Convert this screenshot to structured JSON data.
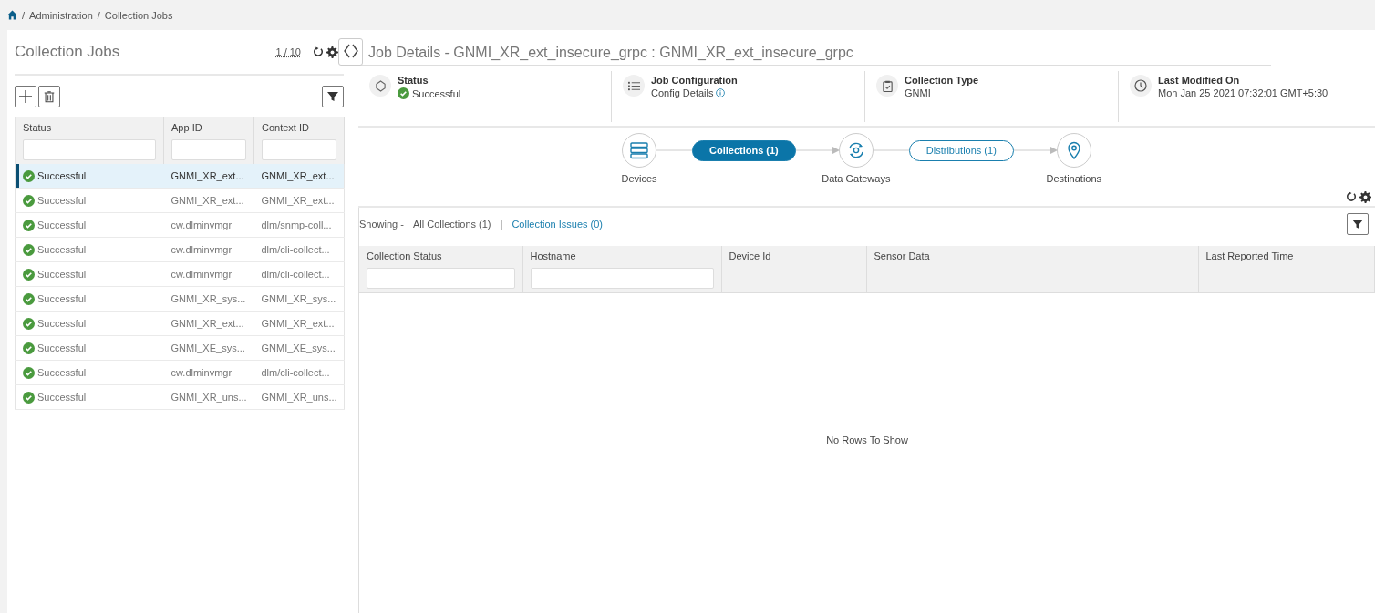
{
  "breadcrumb": {
    "items": [
      "/",
      "Administration",
      "/",
      "Collection Jobs"
    ]
  },
  "jobs_panel": {
    "title": "Collection Jobs",
    "pager": "1 / 10",
    "columns": [
      "Status",
      "App ID",
      "Context ID"
    ],
    "rows": [
      {
        "status": "Successful",
        "app_id": "GNMI_XR_ext...",
        "context_id": "GNMI_XR_ext...",
        "selected": true
      },
      {
        "status": "Successful",
        "app_id": "GNMI_XR_ext...",
        "context_id": "GNMI_XR_ext...",
        "selected": false
      },
      {
        "status": "Successful",
        "app_id": "cw.dlminvmgr",
        "context_id": "dlm/snmp-coll...",
        "selected": false
      },
      {
        "status": "Successful",
        "app_id": "cw.dlminvmgr",
        "context_id": "dlm/cli-collect...",
        "selected": false
      },
      {
        "status": "Successful",
        "app_id": "cw.dlminvmgr",
        "context_id": "dlm/cli-collect...",
        "selected": false
      },
      {
        "status": "Successful",
        "app_id": "GNMI_XR_sys...",
        "context_id": "GNMI_XR_sys...",
        "selected": false
      },
      {
        "status": "Successful",
        "app_id": "GNMI_XR_ext...",
        "context_id": "GNMI_XR_ext...",
        "selected": false
      },
      {
        "status": "Successful",
        "app_id": "GNMI_XE_sys...",
        "context_id": "GNMI_XE_sys...",
        "selected": false
      },
      {
        "status": "Successful",
        "app_id": "cw.dlminvmgr",
        "context_id": "dlm/cli-collect...",
        "selected": false
      },
      {
        "status": "Successful",
        "app_id": "GNMI_XR_uns...",
        "context_id": "GNMI_XR_uns...",
        "selected": false
      }
    ]
  },
  "job_details": {
    "title": "Job Details - GNMI_XR_ext_insecure_grpc : GNMI_XR_ext_insecure_grpc",
    "summary": [
      {
        "kind": "status",
        "label": "Status",
        "value": "Successful"
      },
      {
        "kind": "config",
        "label": "Job Configuration",
        "value": "Config Details"
      },
      {
        "kind": "type",
        "label": "Collection Type",
        "value": "GNMI"
      },
      {
        "kind": "time",
        "label": "Last Modified On",
        "value": "Mon Jan 25 2021 07:32:01 GMT+5:30"
      }
    ],
    "pipeline": [
      {
        "kind": "node",
        "label": "Devices"
      },
      {
        "kind": "pill",
        "label": "Collections (1)",
        "selected": true
      },
      {
        "kind": "node",
        "label": "Data Gateways"
      },
      {
        "kind": "pill",
        "label": "Distributions (1)",
        "selected": false
      },
      {
        "kind": "node",
        "label": "Destinations"
      }
    ],
    "showing": {
      "label": "Showing -",
      "separator": "|",
      "filters": [
        {
          "label": "All Collections (1)",
          "selected": true
        },
        {
          "label": "Collection Issues (0)",
          "selected": false
        }
      ]
    },
    "columns": [
      {
        "label": "Collection Status",
        "filter": true
      },
      {
        "label": "Hostname",
        "filter": true
      },
      {
        "label": "Device Id",
        "filter": false
      },
      {
        "label": "Sensor Data",
        "filter": false
      },
      {
        "label": "Last Reported Time",
        "filter": false
      }
    ],
    "empty_message": "No Rows To Show"
  }
}
